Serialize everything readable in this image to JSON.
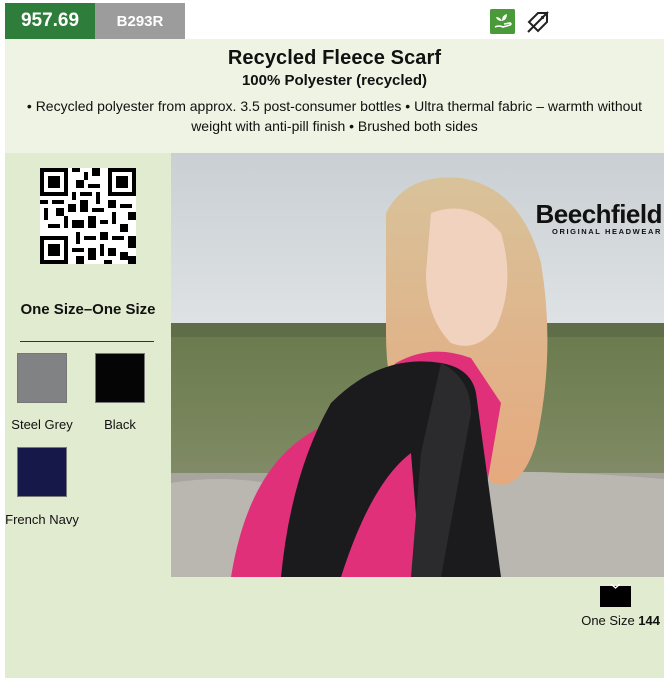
{
  "product": {
    "code": "957.69",
    "reference": "B293R",
    "title": "Recycled Fleece Scarf",
    "material": "100% Polyester (recycled)",
    "description": "• Recycled polyester from approx. 3.5 post-consumer bottles • Ultra thermal fabric – warmth without weight with anti-pill finish • Brushed both sides"
  },
  "badges": {
    "code_bg": "#2e7d3a",
    "ref_bg": "#9c9c9c",
    "icons": [
      "eco-sustainable-icon",
      "no-label-tag-icon"
    ]
  },
  "sidebar": {
    "qr_icon": "qr-code-icon",
    "size_title": "One Size–One Size",
    "colors": [
      {
        "name": "Steel Grey",
        "hex": "#808283"
      },
      {
        "name": "Black",
        "hex": "#050505"
      },
      {
        "name": "French Navy",
        "hex": "#16184a"
      }
    ]
  },
  "brand": {
    "name": "Beechfield",
    "tagline": "ORIGINAL HEADWEAR"
  },
  "sizes": {
    "icon": "packaging-box-icon",
    "label": "One Size",
    "quantity": "144"
  }
}
